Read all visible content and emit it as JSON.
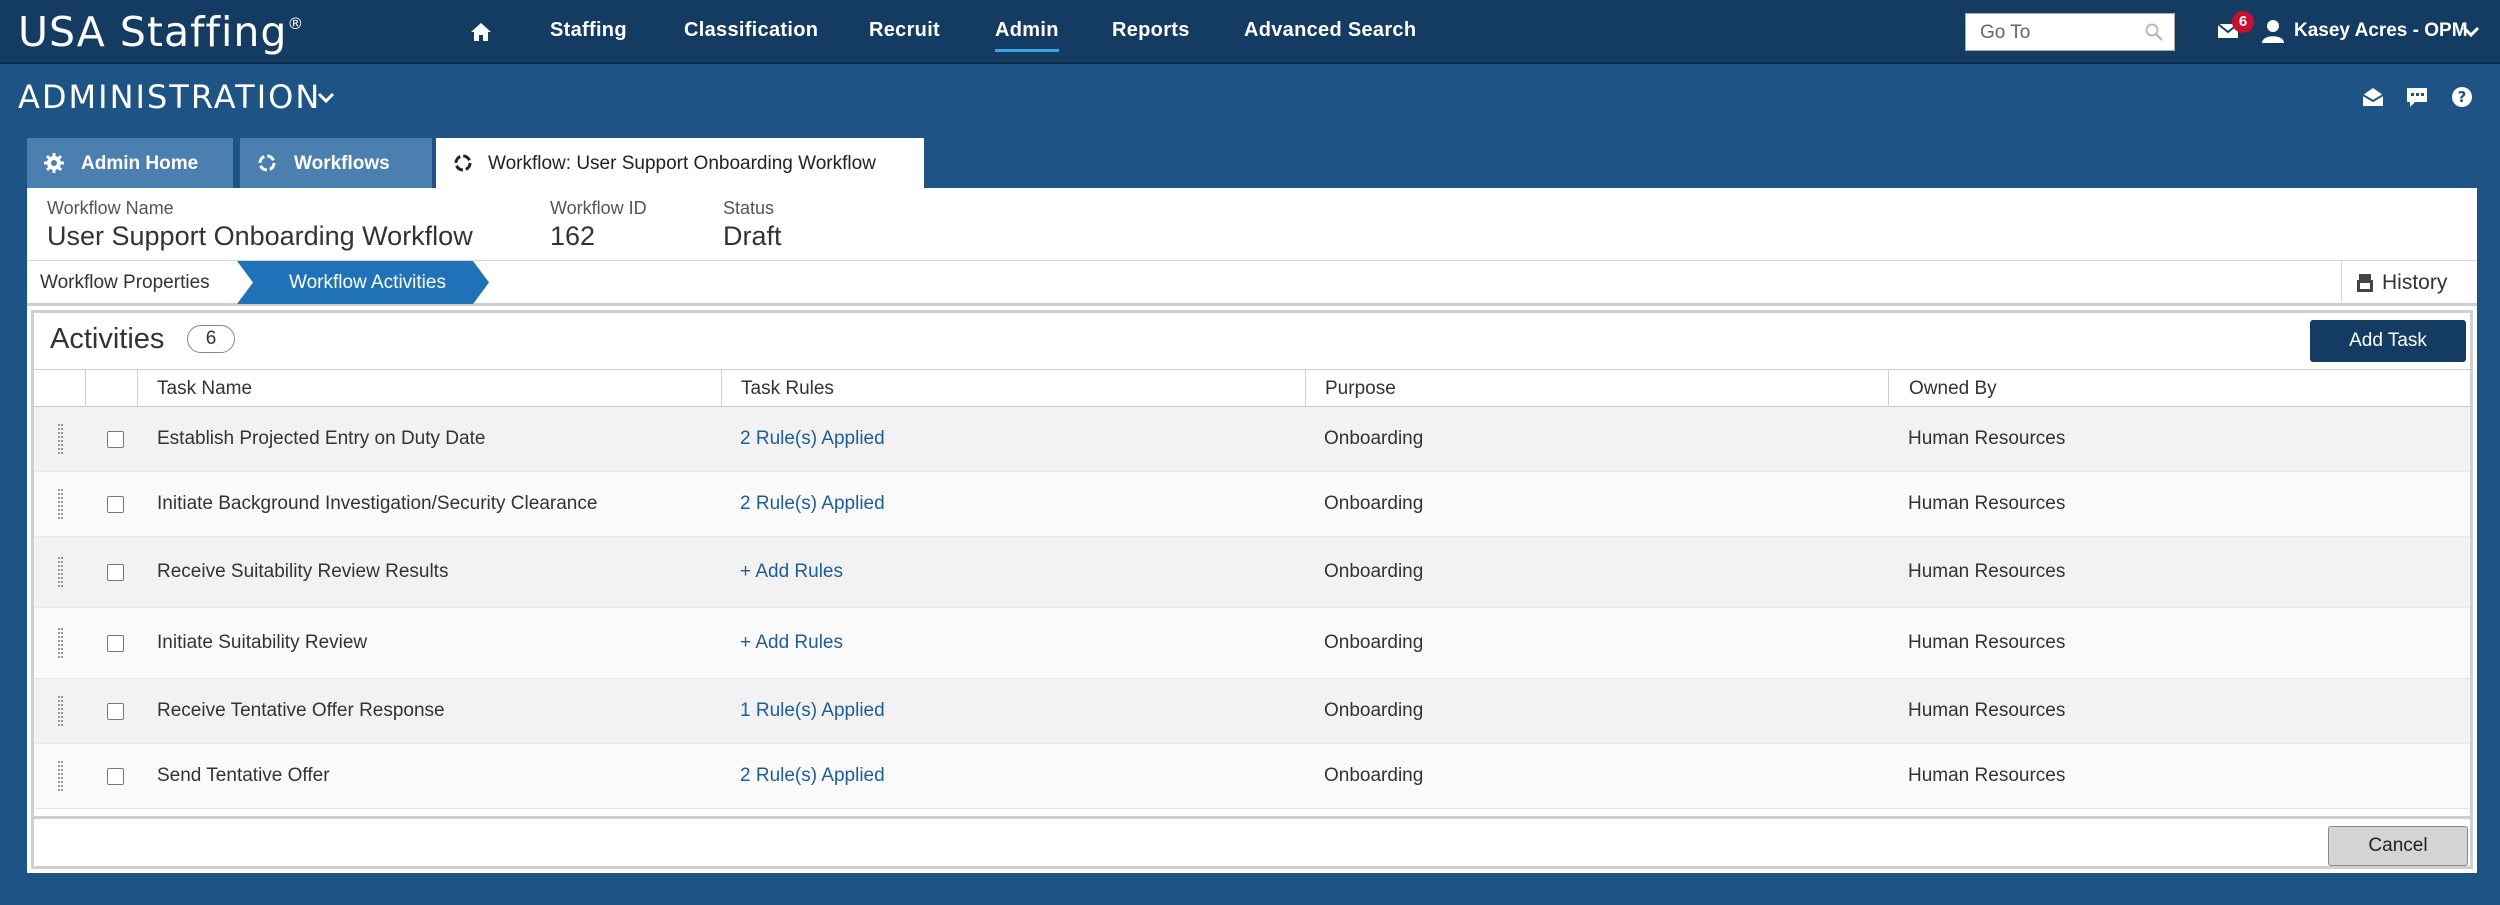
{
  "topnav": {
    "brand": "USA Staffing",
    "brand_mark": "®",
    "items": [
      {
        "label": "Staffing"
      },
      {
        "label": "Classification"
      },
      {
        "label": "Recruit"
      },
      {
        "label": "Admin",
        "active": true
      },
      {
        "label": "Reports"
      },
      {
        "label": "Advanced Search"
      }
    ],
    "goto_placeholder": "Go To",
    "mail_count": "6",
    "user_name": "Kasey Acres - OPM"
  },
  "page": {
    "title": "ADMINISTRATION"
  },
  "tabs": [
    {
      "label": "Admin Home",
      "icon": "gear-icon"
    },
    {
      "label": "Workflows",
      "icon": "workflow-icon"
    },
    {
      "label": "Workflow: User Support Onboarding Workflow",
      "icon": "workflow-icon",
      "active": true
    }
  ],
  "workflow": {
    "name_label": "Workflow Name",
    "name": "User Support Onboarding Workflow",
    "id_label": "Workflow ID",
    "id": "162",
    "status_label": "Status",
    "status": "Draft"
  },
  "steps": {
    "properties": "Workflow Properties",
    "activities": "Workflow Activities",
    "history": "History"
  },
  "activities": {
    "title": "Activities",
    "count": "6",
    "add_task": "Add Task",
    "columns": [
      "Task Name",
      "Task Rules",
      "Purpose",
      "Owned By"
    ],
    "rows": [
      {
        "task": "Establish Projected Entry on Duty Date",
        "rules": "2 Rule(s) Applied",
        "purpose": "Onboarding",
        "owner": "Human Resources"
      },
      {
        "task": "Initiate Background Investigation/Security Clearance",
        "rules": "2 Rule(s) Applied",
        "purpose": "Onboarding",
        "owner": "Human Resources"
      },
      {
        "task": "Receive Suitability Review Results",
        "rules": "+ Add Rules",
        "purpose": "Onboarding",
        "owner": "Human Resources"
      },
      {
        "task": "Initiate Suitability Review",
        "rules": "+ Add Rules",
        "purpose": "Onboarding",
        "owner": "Human Resources"
      },
      {
        "task": "Receive Tentative Offer Response",
        "rules": "1 Rule(s) Applied",
        "purpose": "Onboarding",
        "owner": "Human Resources"
      },
      {
        "task": "Send Tentative Offer",
        "rules": "2 Rule(s) Applied",
        "purpose": "Onboarding",
        "owner": "Human Resources"
      }
    ],
    "cancel": "Cancel"
  }
}
